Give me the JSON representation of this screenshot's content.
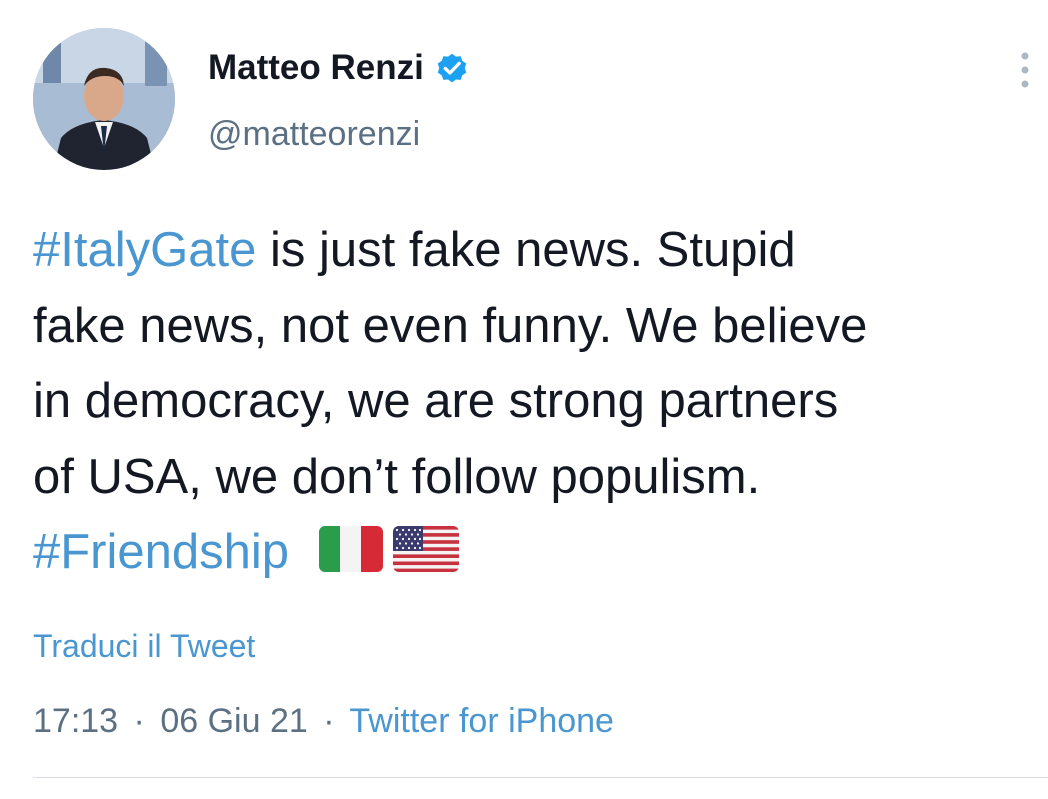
{
  "author": {
    "name": "Matteo Renzi",
    "handle": "@matteorenzi",
    "verified": true,
    "avatar_icon": "profile-photo"
  },
  "tweet": {
    "lines": [
      {
        "hashtag": "#ItalyGate",
        "text": " is just fake news. Stupid"
      },
      {
        "text": "fake news, not even funny. We believe"
      },
      {
        "text": "in democracy, we are strong partners"
      },
      {
        "text": "of USA, we don’t follow populism."
      }
    ],
    "closing_hashtag": "#Friendship",
    "emoji": [
      "italy-flag",
      "usa-flag"
    ]
  },
  "translate_label": "Traduci il Tweet",
  "meta": {
    "time": "17:13",
    "separator": "·",
    "date": "06 Giu 21",
    "source": "Twitter for iPhone"
  },
  "colors": {
    "link": "#4a96d1",
    "secondary_text": "#5b7083",
    "verified": "#1da1f2"
  }
}
